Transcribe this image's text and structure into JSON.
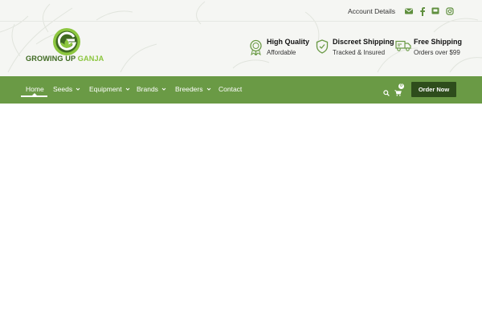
{
  "topbar": {
    "account_link": "Account Details",
    "social": [
      "email-icon",
      "facebook-icon",
      "message-icon",
      "instagram-icon"
    ]
  },
  "logo": {
    "mark_letter": "G",
    "name_part1": "GROWING UP ",
    "name_part2": "GANJA"
  },
  "features": [
    {
      "icon": "award-icon",
      "title": "High Quality",
      "subtitle": "Affordable"
    },
    {
      "icon": "shield-icon",
      "title": "Discreet Shipping",
      "subtitle": "Tracked & Insured"
    },
    {
      "icon": "truck-icon",
      "title": "Free Shipping",
      "subtitle": "Orders over $99"
    }
  ],
  "nav": {
    "items": [
      {
        "label": "Home",
        "active": true,
        "dropdown": false
      },
      {
        "label": "Seeds",
        "dropdown": true
      },
      {
        "label": "Equipment",
        "dropdown": true
      },
      {
        "label": "Brands",
        "dropdown": true
      },
      {
        "label": "Breeders",
        "dropdown": true
      },
      {
        "label": "Contact",
        "dropdown": false
      }
    ],
    "cart_count": "0",
    "order_button": "Order Now"
  },
  "colors": {
    "nav_green": "#6a9a45",
    "dark_green": "#2e4d1c",
    "logo_green": "#3f6a22",
    "accent_green": "#8cc63f"
  }
}
